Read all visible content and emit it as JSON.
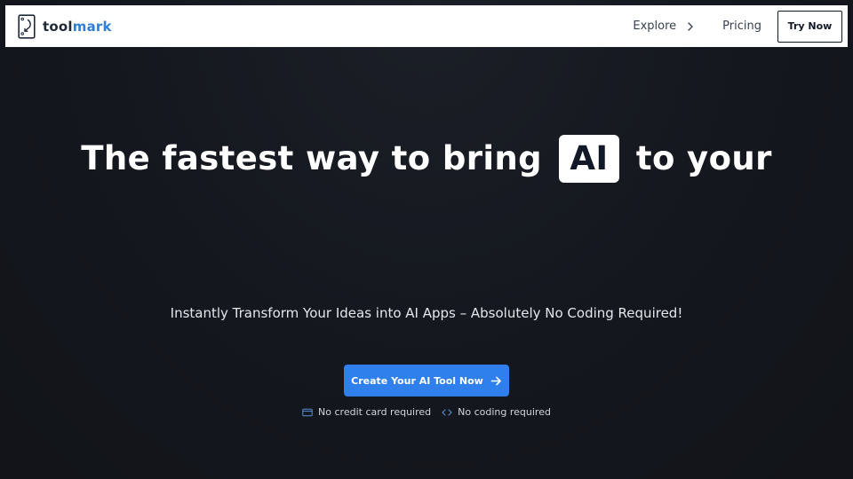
{
  "brand": {
    "name_part1": "tool",
    "name_part2": "mark",
    "logo_icon": "logo-mark-icon",
    "accent_color": "#2f7fd8"
  },
  "nav": {
    "explore_label": "Explore",
    "explore_icon": "chevron-right-icon",
    "pricing_label": "Pricing",
    "try_now_label": "Try Now"
  },
  "hero": {
    "title_before": "The fastest way to bring",
    "title_highlight": "AI",
    "title_after": "to your",
    "subtitle": "Instantly Transform Your Ideas into AI Apps – Absolutely No Coding Required!",
    "cta_label": "Create Your AI Tool Now",
    "cta_icon": "arrow-right-icon",
    "cta_color": "#2f80ed"
  },
  "features": [
    {
      "icon": "credit-card-icon",
      "label": "No credit card required"
    },
    {
      "icon": "code-icon",
      "label": "No coding required"
    }
  ],
  "colors": {
    "background": "#13161d",
    "navbar": "#ffffff"
  }
}
